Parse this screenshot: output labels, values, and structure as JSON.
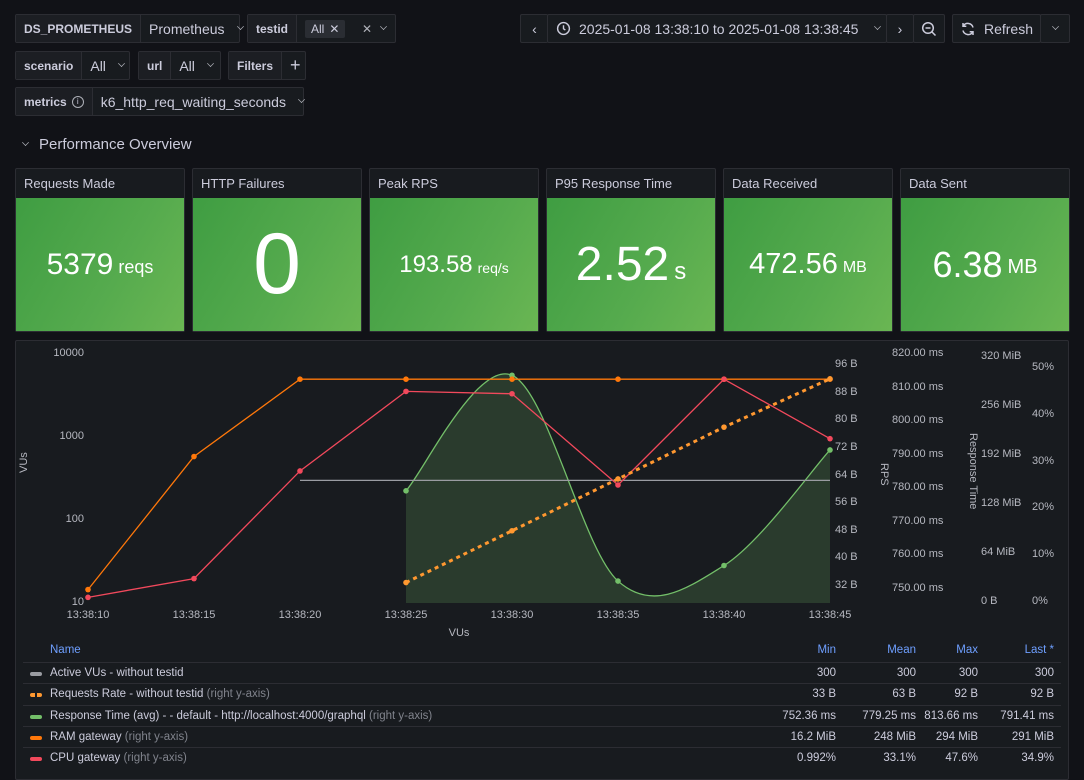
{
  "variables": {
    "ds": {
      "label": "DS_PROMETHEUS",
      "value": "Prometheus"
    },
    "testid": {
      "label": "testid",
      "chip": "All"
    },
    "scenario": {
      "label": "scenario",
      "value": "All"
    },
    "url": {
      "label": "url",
      "value": "All"
    },
    "filters": {
      "label": "Filters",
      "add": "+"
    },
    "metrics": {
      "label": "metrics",
      "value": "k6_http_req_waiting_seconds"
    }
  },
  "toolbar": {
    "time_range": "2025-01-08 13:38:10 to 2025-01-08 13:38:45",
    "refresh_label": "Refresh"
  },
  "section": {
    "title": "Performance Overview"
  },
  "stats": [
    {
      "title": "Requests Made",
      "value": "5379",
      "unit": "reqs"
    },
    {
      "title": "HTTP Failures",
      "value": "0",
      "unit": ""
    },
    {
      "title": "Peak RPS",
      "value": "193.58",
      "unit": "req/s"
    },
    {
      "title": "P95 Response Time",
      "value": "2.52",
      "unit": "s"
    },
    {
      "title": "Data Received",
      "value": "472.56",
      "unit": "MB"
    },
    {
      "title": "Data Sent",
      "value": "6.38",
      "unit": "MB"
    }
  ],
  "chart_data": {
    "type": "line",
    "title": "",
    "xlabel": "VUs",
    "x": [
      "13:38:10",
      "13:38:15",
      "13:38:20",
      "13:38:25",
      "13:38:30",
      "13:38:35",
      "13:38:40",
      "13:38:45"
    ],
    "axes": {
      "left": {
        "label": "VUs",
        "scale": "log",
        "ticks": [
          "10",
          "100",
          "1000",
          "10000"
        ],
        "range": [
          10,
          10000
        ]
      },
      "right_rps": {
        "label": "RPS",
        "ticks": [
          "32 B",
          "40 B",
          "48 B",
          "56 B",
          "64 B",
          "72 B",
          "80 B",
          "88 B",
          "96 B"
        ],
        "range": [
          32,
          96
        ]
      },
      "right_response": {
        "label": "Response Time",
        "ticks": [
          "750.00 ms",
          "760.00 ms",
          "770.00 ms",
          "780.00 ms",
          "790.00 ms",
          "800.00 ms",
          "810.00 ms",
          "820.00 ms"
        ],
        "range": [
          750,
          820
        ]
      },
      "right_ram": {
        "ticks": [
          "0 B",
          "64 MiB",
          "128 MiB",
          "192 MiB",
          "256 MiB",
          "320 MiB"
        ],
        "range": [
          0,
          320
        ]
      },
      "right_cpu": {
        "ticks": [
          "0%",
          "10%",
          "20%",
          "30%",
          "40%",
          "50%"
        ],
        "range": [
          0,
          50
        ]
      }
    },
    "series": [
      {
        "name": "Active VUs - without testid",
        "color": "#9a9ca2",
        "style": "solid",
        "axis": "left",
        "values": [
          null,
          null,
          300,
          300,
          300,
          300,
          300,
          300
        ]
      },
      {
        "name": "Requests Rate - without testid",
        "color": "#ff9830",
        "style": "dashed",
        "axis": "right_rps",
        "values": [
          null,
          null,
          null,
          33,
          48,
          63,
          78,
          92
        ]
      },
      {
        "name": "Response Time (avg) - - default - http://localhost:4000/graphql",
        "color": "#73bf69",
        "style": "smooth-area",
        "axis": "right_response",
        "values": [
          null,
          null,
          null,
          779.25,
          813.66,
          752.36,
          757,
          791.41
        ]
      },
      {
        "name": "RAM gateway",
        "color": "#ff780a",
        "style": "solid",
        "axis": "right_ram",
        "values": [
          16.2,
          190,
          291,
          291,
          291,
          291,
          291,
          291
        ]
      },
      {
        "name": "CPU gateway",
        "color": "#f2495c",
        "style": "solid",
        "axis": "right_cpu",
        "values": [
          0.992,
          5,
          28,
          45,
          44.5,
          25,
          47.6,
          34.9
        ]
      }
    ]
  },
  "legend": {
    "headers": {
      "name": "Name",
      "min": "Min",
      "mean": "Mean",
      "max": "Max",
      "last": "Last *"
    },
    "axis_note": "(right y-axis)",
    "rows": [
      {
        "name": "Active VUs - without testid",
        "right": false,
        "color": "#9a9ca2",
        "dashed": false,
        "min": "300",
        "mean": "300",
        "max": "300",
        "last": "300"
      },
      {
        "name": "Requests Rate - without testid",
        "right": true,
        "color": "#ff9830",
        "dashed": true,
        "min": "33 B",
        "mean": "63 B",
        "max": "92 B",
        "last": "92 B"
      },
      {
        "name": "Response Time (avg) - - default - http://localhost:4000/graphql",
        "right": true,
        "color": "#73bf69",
        "dashed": false,
        "min": "752.36 ms",
        "mean": "779.25 ms",
        "max": "813.66 ms",
        "last": "791.41 ms"
      },
      {
        "name": "RAM gateway",
        "right": true,
        "color": "#ff780a",
        "dashed": false,
        "min": "16.2 MiB",
        "mean": "248 MiB",
        "max": "294 MiB",
        "last": "291 MiB"
      },
      {
        "name": "CPU gateway",
        "right": true,
        "color": "#f2495c",
        "dashed": false,
        "min": "0.992%",
        "mean": "33.1%",
        "max": "47.6%",
        "last": "34.9%"
      }
    ]
  }
}
